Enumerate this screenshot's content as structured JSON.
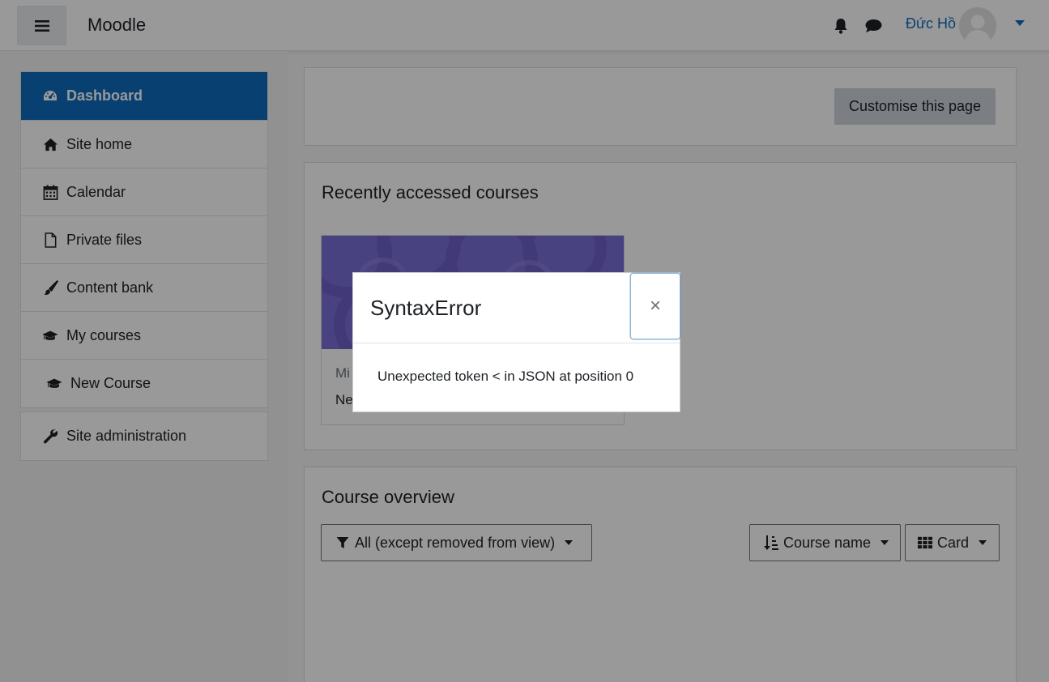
{
  "navbar": {
    "menu_icon": "hamburger-icon",
    "brand": "Moodle",
    "notification_icon": "bell-icon",
    "messages_icon": "chat-bubble-icon",
    "user_name": "Đức Hồ",
    "avatar_icon": "avatar-placeholder",
    "user_menu_icon": "caret-down-icon"
  },
  "sidebar": {
    "items": [
      {
        "label": "Dashboard",
        "icon": "tachometer-icon",
        "active": true
      },
      {
        "label": "Site home",
        "icon": "home-icon"
      },
      {
        "label": "Calendar",
        "icon": "calendar-icon"
      },
      {
        "label": "Private files",
        "icon": "file-icon"
      },
      {
        "label": "Content bank",
        "icon": "paintbrush-icon"
      },
      {
        "label": "My courses",
        "icon": "graduation-cap-icon"
      },
      {
        "label": "New Course",
        "icon": "graduation-cap-icon"
      }
    ],
    "admin": {
      "label": "Site administration",
      "icon": "wrench-icon"
    }
  },
  "main": {
    "customise_button": "Customise this page",
    "recent": {
      "title": "Recently accessed courses",
      "course_category_partial": "Mi",
      "course_name_partial": "Ne"
    },
    "overview": {
      "title": "Course overview",
      "filter": "All (except removed from view)",
      "sort": "Course name",
      "view": "Card"
    }
  },
  "modal": {
    "title": "SyntaxError",
    "close_symbol": "×",
    "message": "Unexpected token < in JSON at position 0"
  },
  "colors": {
    "primary": "#0f6cbf",
    "secondary_button": "#ced4da",
    "course_image": "#7b6fd6"
  }
}
